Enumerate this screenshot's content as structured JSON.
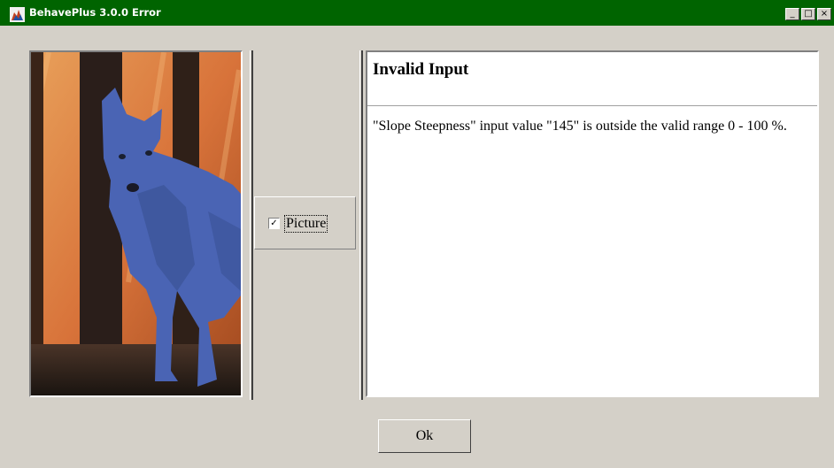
{
  "window": {
    "title": "BehavePlus 3.0.0 Error",
    "minimize": "_",
    "maximize": "□",
    "close": "×"
  },
  "picture_toggle": {
    "label": "Picture",
    "checked": true,
    "check_mark": "✓"
  },
  "message": {
    "title": "Invalid Input",
    "body": "\"Slope Steepness\" input value \"145\" is outside the valid range 0 - 100 %."
  },
  "buttons": {
    "ok": "Ok"
  },
  "colors": {
    "titlebar": "#006400",
    "dialog_bg": "#d4d0c8",
    "wolf": "#4a64b4"
  }
}
